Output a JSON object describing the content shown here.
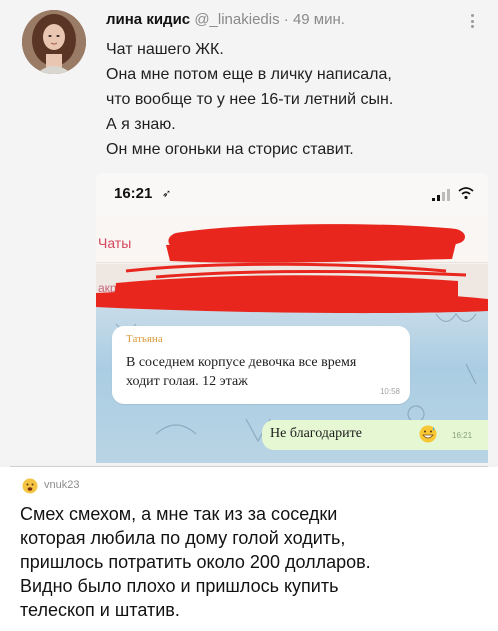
{
  "tweet": {
    "author_name": "лина кидис",
    "author_handle": "@_linakiedis",
    "separator": "·",
    "time": "49 мин.",
    "lines": [
      "Чат нашего ЖК.",
      "Она мне потом еще в личку написала,",
      "что вообще то у нее 16-ти летний сын.",
      "А я знаю.",
      "Он мне огоньки на сторис ставит."
    ]
  },
  "screenshot": {
    "clock": "16:21",
    "back_label": "Чаты",
    "subbar_text": "акре",
    "incoming": {
      "sender": "Татьяна",
      "text": "В соседнем корпусе девочка все время ходит голая. 12 этаж",
      "time": "10:58"
    },
    "outgoing": {
      "text": "Не благодарите",
      "time": "16:21"
    },
    "scribble_color": "#e8261e"
  },
  "comment": {
    "username": "vnuk23",
    "lines": [
      "Смех смехом, а мне так из за соседки",
      "которая любила по дому голой ходить,",
      "пришлось потратить около 200 долларов.",
      "Видно было плохо и пришлось купить",
      "телескоп и штатив."
    ]
  }
}
